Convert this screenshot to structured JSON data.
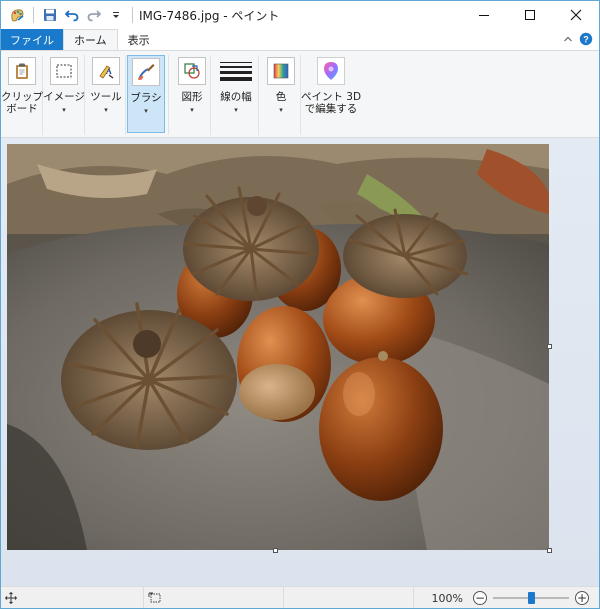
{
  "window": {
    "title": "IMG-7486.jpg - ペイント",
    "minimize_icon": "minimize-icon",
    "maximize_icon": "maximize-icon",
    "close_icon": "close-icon"
  },
  "quick_access": {
    "items": [
      "paint-app-icon",
      "save-icon",
      "undo-icon",
      "redo-icon",
      "customize-dropdown-icon"
    ]
  },
  "tabs": [
    {
      "label": "ファイル"
    },
    {
      "label": "ホーム"
    },
    {
      "label": "表示"
    }
  ],
  "ribbon": {
    "clipboard": {
      "label": "クリップ\nボード"
    },
    "image": {
      "label": "イメージ"
    },
    "tools": {
      "label": "ツール"
    },
    "brush": {
      "label": "ブラシ"
    },
    "shapes": {
      "label": "図形"
    },
    "width": {
      "label": "線の幅"
    },
    "colors": {
      "label": "色"
    },
    "paint3d": {
      "label": "ペイント 3D\nで編集する"
    },
    "caret": "▾"
  },
  "canvas": {
    "subject": "acorns on a rock"
  },
  "status": {
    "zoom": "100%",
    "zoom_minus": "−",
    "zoom_plus": "+",
    "zoom_level": 0.5
  },
  "colors": {
    "accent": "#1979ca",
    "ribbon_bg": "#f5f6f7",
    "canvas_bg": "#dee6f0"
  }
}
